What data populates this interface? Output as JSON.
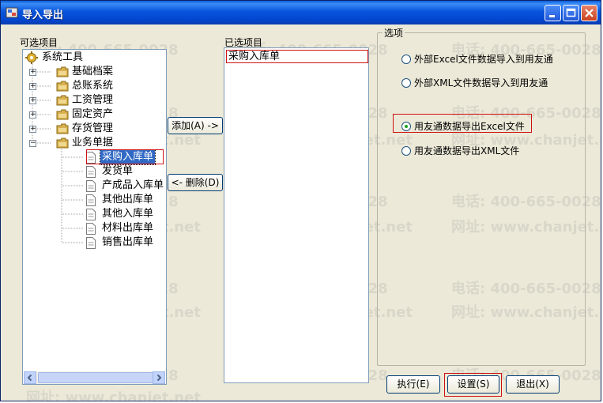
{
  "window": {
    "title": "导入导出",
    "colors": {
      "title_bar": "#0855dd",
      "face": "#ece9d8",
      "highlight_border": "#d01010",
      "selection": "#316ac5"
    }
  },
  "left": {
    "label": "可选项目",
    "tree": {
      "root": "系统工具",
      "folders": [
        "基础档案",
        "总账系统",
        "工资管理",
        "固定资产",
        "存货管理",
        "业务单据"
      ],
      "children": [
        "采购入库单",
        "发货单",
        "产成品入库单",
        "其他出库单",
        "其他入库单",
        "材料出库单",
        "销售出库单"
      ],
      "selected_child": "采购入库单"
    }
  },
  "middle": {
    "add_button": "添加(A) ->",
    "remove_button": "<- 删除(D)"
  },
  "right": {
    "label": "已选项目",
    "items": [
      "采购入库单"
    ]
  },
  "options": {
    "label": "选项",
    "radios": [
      {
        "label": "外部Excel文件数据导入到用友通",
        "checked": false
      },
      {
        "label": "外部XML文件数据导入到用友通",
        "checked": false
      },
      {
        "label": "用友通数据导出Excel文件",
        "checked": true
      },
      {
        "label": "用友通数据导出XML文件",
        "checked": false
      }
    ]
  },
  "footer": {
    "execute": "执行(E)",
    "settings": "设置(S)",
    "exit": "退出(X)"
  },
  "watermark": {
    "phone": "电话: 400-665-0028",
    "url": "网址: www.chanjet.net"
  }
}
